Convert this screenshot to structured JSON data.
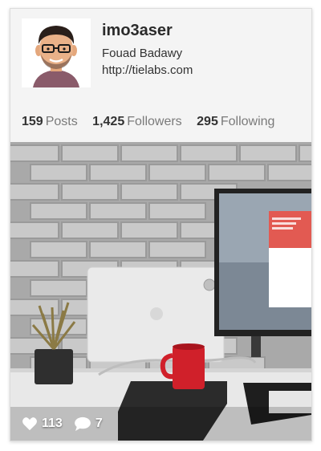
{
  "profile": {
    "username": "imo3aser",
    "full_name": "Fouad Badawy",
    "website": "http://tielabs.com",
    "avatar_icon": "cartoon-avatar-icon"
  },
  "stats": {
    "posts_count": "159",
    "posts_label": "Posts",
    "followers_count": "1,425",
    "followers_label": "Followers",
    "following_count": "295",
    "following_label": "Following"
  },
  "post": {
    "image_description": "desk-workspace-photo",
    "likes": "113",
    "likes_icon": "heart-icon",
    "comments": "7",
    "comments_icon": "comment-icon"
  },
  "colors": {
    "card_bg": "#f4f4f4",
    "text_dark": "#333333",
    "text_muted": "#7a7a7a",
    "mug_red": "#d0202a"
  }
}
